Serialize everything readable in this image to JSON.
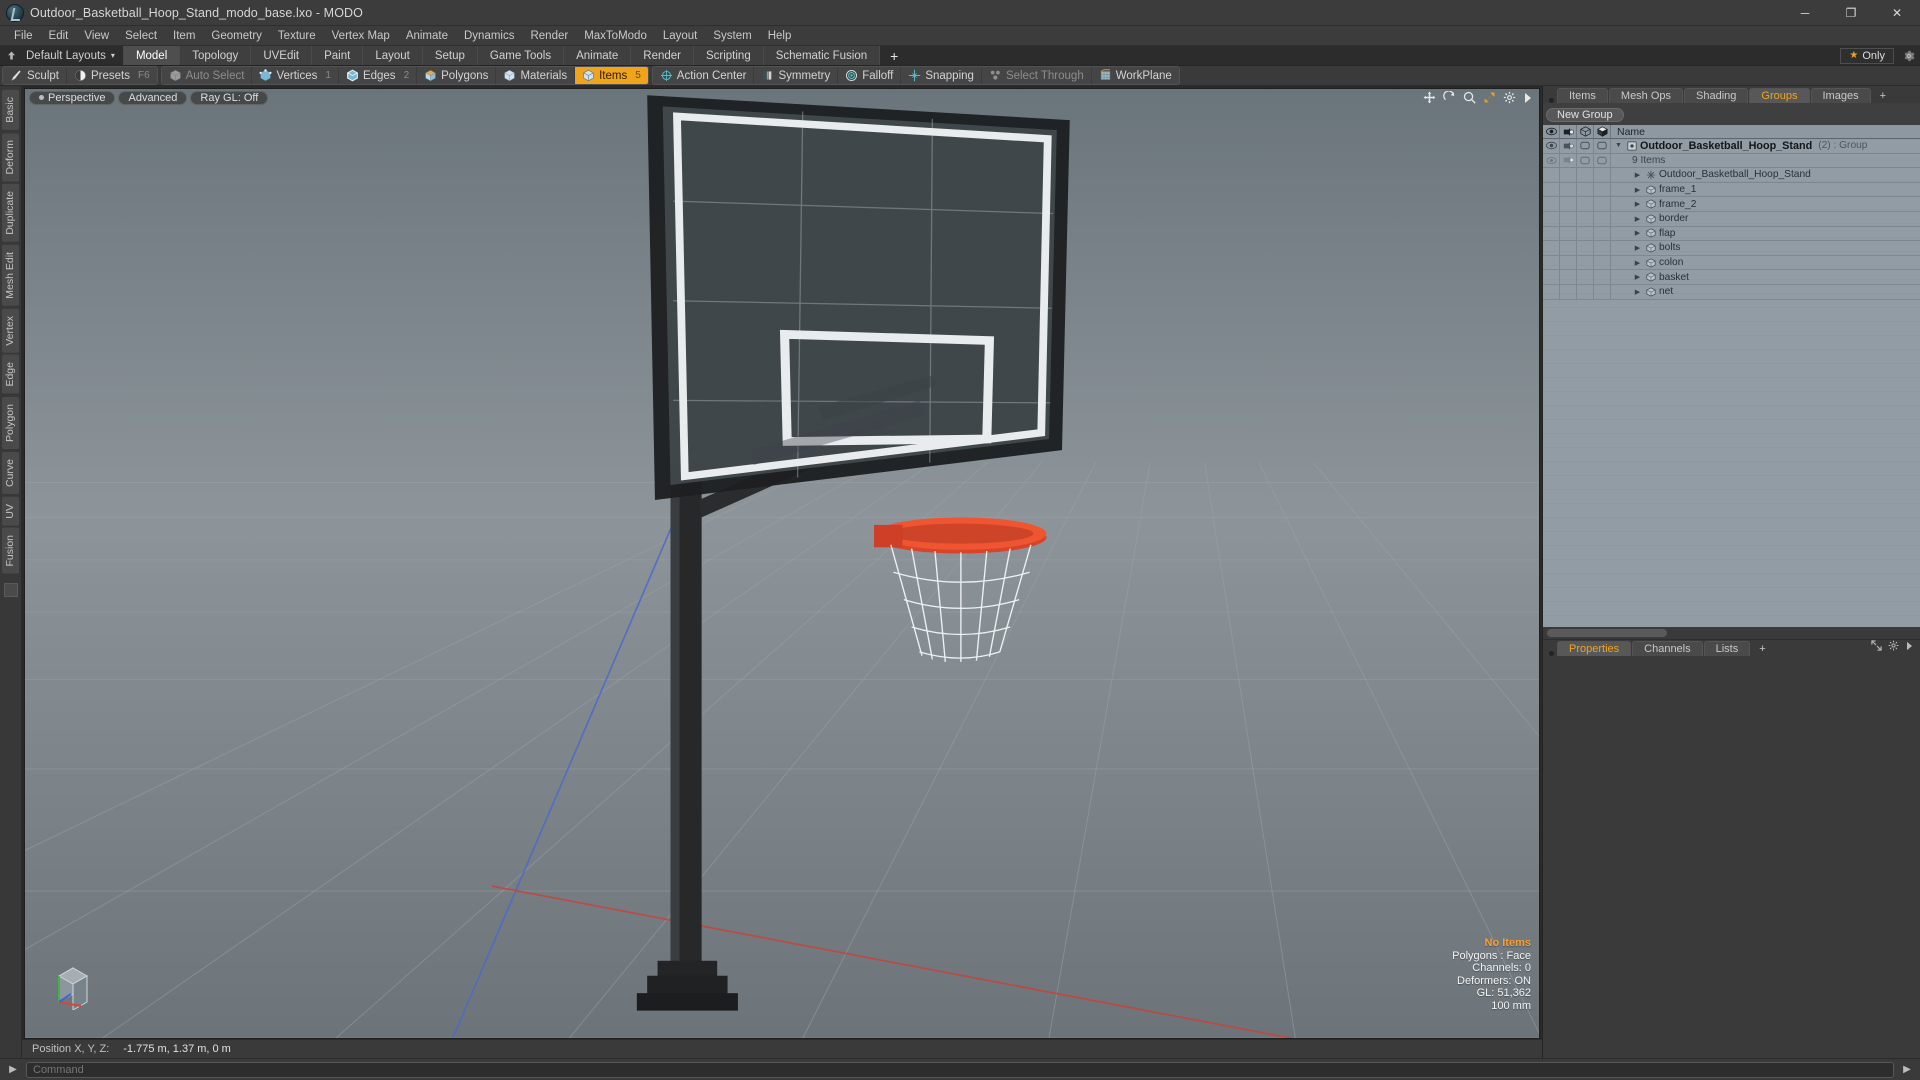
{
  "window": {
    "title": "Outdoor_Basketball_Hoop_Stand_modo_base.lxo - MODO",
    "minimize": "─",
    "maximize": "❐",
    "close": "✕"
  },
  "menubar": {
    "items": [
      "File",
      "Edit",
      "View",
      "Select",
      "Item",
      "Geometry",
      "Texture",
      "Vertex Map",
      "Animate",
      "Dynamics",
      "Render",
      "MaxToModo",
      "Layout",
      "System",
      "Help"
    ]
  },
  "layoutrow": {
    "default_layouts": "Default Layouts",
    "caret": "▾",
    "tabs": [
      {
        "label": "Model",
        "active": true
      },
      {
        "label": "Topology",
        "active": false
      },
      {
        "label": "UVEdit",
        "active": false
      },
      {
        "label": "Paint",
        "active": false
      },
      {
        "label": "Layout",
        "active": false
      },
      {
        "label": "Setup",
        "active": false
      },
      {
        "label": "Game Tools",
        "active": false
      },
      {
        "label": "Animate",
        "active": false
      },
      {
        "label": "Render",
        "active": false
      },
      {
        "label": "Scripting",
        "active": false
      },
      {
        "label": "Schematic Fusion",
        "active": false
      }
    ],
    "add_tab": "+",
    "only_label": "Only",
    "star": "★"
  },
  "toolbar": {
    "groups": [
      {
        "buttons": [
          {
            "label": "Sculpt",
            "icon": "brush-icon",
            "state": "normal",
            "hint": ""
          },
          {
            "label": "Presets",
            "icon": "sphere-icon",
            "state": "normal",
            "hint": "F6"
          }
        ]
      },
      {
        "buttons": [
          {
            "label": "Auto Select",
            "icon": "cube-grey-icon",
            "state": "dim",
            "hint": ""
          },
          {
            "label": "Vertices",
            "icon": "cube-vertices-icon",
            "state": "normal",
            "hint": "1"
          },
          {
            "label": "Edges",
            "icon": "cube-edges-icon",
            "state": "normal",
            "hint": "2"
          },
          {
            "label": "Polygons",
            "icon": "cube-polygons-icon",
            "state": "normal",
            "hint": ""
          },
          {
            "label": "Materials",
            "icon": "cube-materials-icon",
            "state": "normal",
            "hint": ""
          },
          {
            "label": "Items",
            "icon": "cube-items-icon",
            "state": "active",
            "hint": "5"
          }
        ]
      },
      {
        "buttons": [
          {
            "label": "Action Center",
            "icon": "action-center-icon",
            "state": "normal",
            "hint": ""
          },
          {
            "label": "Symmetry",
            "icon": "symmetry-icon",
            "state": "normal",
            "hint": ""
          },
          {
            "label": "Falloff",
            "icon": "falloff-icon",
            "state": "normal",
            "hint": ""
          },
          {
            "label": "Snapping",
            "icon": "snapping-icon",
            "state": "normal",
            "hint": ""
          },
          {
            "label": "Select Through",
            "icon": "select-through-icon",
            "state": "dim",
            "hint": ""
          },
          {
            "label": "WorkPlane",
            "icon": "workplane-icon",
            "state": "normal",
            "hint": ""
          }
        ]
      }
    ]
  },
  "left_tabs": [
    "Basic",
    "Deform",
    "Duplicate",
    "Mesh Edit",
    "Vertex",
    "Edge",
    "Polygon",
    "Curve",
    "UV",
    "Fusion"
  ],
  "viewport": {
    "buttons": [
      {
        "label": "Perspective",
        "icon": "view-dot-icon"
      },
      {
        "label": "Advanced",
        "icon": ""
      },
      {
        "label": "Ray GL: Off",
        "icon": ""
      }
    ],
    "icons": [
      "move-icon",
      "rotate-icon",
      "zoom-icon",
      "fit-icon",
      "gear-icon",
      "chevron-right-icon"
    ],
    "stats": {
      "no_items": "No Items",
      "polygons": "Polygons : Face",
      "channels": "Channels: 0",
      "deformers": "Deformers: ON",
      "gl": "GL: 51,362",
      "units": "100 mm"
    }
  },
  "statusbar": {
    "position_label": "Position X, Y, Z:",
    "position_value": "-1.775 m, 1.37 m, 0 m"
  },
  "right_panel": {
    "tabs": [
      {
        "label": "Items",
        "active": false
      },
      {
        "label": "Mesh Ops",
        "active": false
      },
      {
        "label": "Shading",
        "active": false
      },
      {
        "label": "Groups",
        "active": true
      },
      {
        "label": "Images",
        "active": false
      },
      {
        "label": "+",
        "active": false
      }
    ],
    "new_group_button": "New Group",
    "tree_columns": [
      "visible-eye-icon",
      "render-camera-icon",
      "wireframe-cube-icon",
      "shaded-cube-icon"
    ],
    "name_column": "Name",
    "rows": [
      {
        "name": "Outdoor_Basketball_Hoop_Stand",
        "meta": "(2) : Group",
        "type": "group",
        "depth": 0,
        "icon": "group-icon"
      },
      {
        "name": "9 Items",
        "meta": "",
        "type": "count",
        "depth": 1,
        "icon": ""
      },
      {
        "name": "Outdoor_Basketball_Hoop_Stand",
        "meta": "",
        "type": "mesh",
        "depth": 2,
        "icon": "locator-icon"
      },
      {
        "name": "frame_1",
        "meta": "",
        "type": "mesh",
        "depth": 2,
        "icon": "mesh-icon"
      },
      {
        "name": "frame_2",
        "meta": "",
        "type": "mesh",
        "depth": 2,
        "icon": "mesh-icon"
      },
      {
        "name": "border",
        "meta": "",
        "type": "mesh",
        "depth": 2,
        "icon": "mesh-icon"
      },
      {
        "name": "flap",
        "meta": "",
        "type": "mesh",
        "depth": 2,
        "icon": "mesh-icon"
      },
      {
        "name": "bolts",
        "meta": "",
        "type": "mesh",
        "depth": 2,
        "icon": "mesh-icon"
      },
      {
        "name": "colon",
        "meta": "",
        "type": "mesh",
        "depth": 2,
        "icon": "mesh-icon"
      },
      {
        "name": "basket",
        "meta": "",
        "type": "mesh",
        "depth": 2,
        "icon": "mesh-icon"
      },
      {
        "name": "net",
        "meta": "",
        "type": "mesh",
        "depth": 2,
        "icon": "mesh-icon"
      }
    ],
    "bottom_tabs": [
      {
        "label": "Properties",
        "active": true
      },
      {
        "label": "Channels",
        "active": false
      },
      {
        "label": "Lists",
        "active": false
      },
      {
        "label": "+",
        "active": false
      }
    ]
  },
  "command_bar": {
    "placeholder": "Command",
    "value": "",
    "left_arrow": "▶",
    "right_arrow": "▶"
  },
  "colors": {
    "accent": "#f0a41c",
    "rim": "#d9432a",
    "panel": "#3a3a3a",
    "tree": "#8d98a1"
  }
}
